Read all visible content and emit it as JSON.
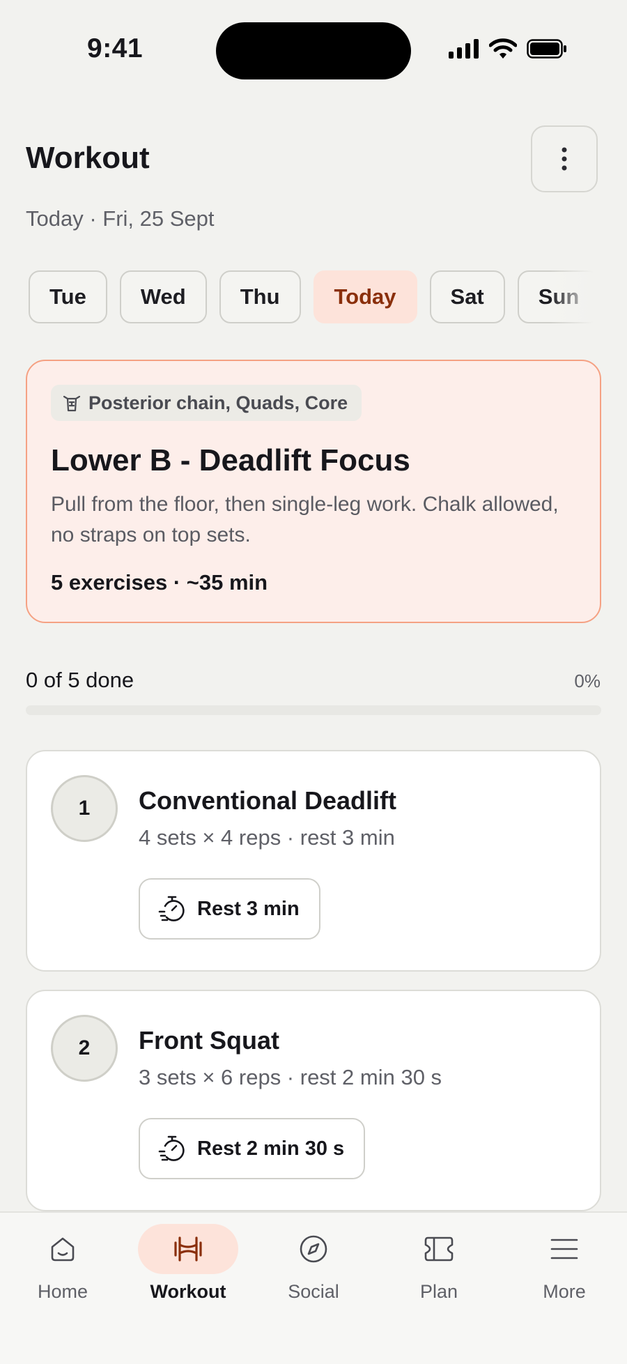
{
  "status": {
    "time": "9:41"
  },
  "header": {
    "title": "Workout",
    "subtitle": "Today · Fri, 25 Sept"
  },
  "days": [
    "Tue",
    "Wed",
    "Thu",
    "Today",
    "Sat",
    "Sun"
  ],
  "active_day": "Today",
  "workout": {
    "tag": "Posterior chain, Quads, Core",
    "title": "Lower B - Deadlift Focus",
    "description": "Pull from the floor, then single-leg work. Chalk allowed, no straps on top sets.",
    "meta": "5 exercises · ~35 min"
  },
  "progress": {
    "label": "0 of 5 done",
    "percent_label": "0%",
    "value": 0
  },
  "exercises": [
    {
      "number": "1",
      "name": "Conventional Deadlift",
      "detail": "4 sets × 4 reps · rest 3 min",
      "rest_label": "Rest 3 min"
    },
    {
      "number": "2",
      "name": "Front Squat",
      "detail": "3 sets × 6 reps · rest 2 min 30 s",
      "rest_label": "Rest 2 min 30 s"
    }
  ],
  "tabs": [
    {
      "label": "Home",
      "icon": "home-icon"
    },
    {
      "label": "Workout",
      "icon": "dumbbell-icon"
    },
    {
      "label": "Social",
      "icon": "compass-icon"
    },
    {
      "label": "Plan",
      "icon": "plan-icon"
    },
    {
      "label": "More",
      "icon": "menu-icon"
    }
  ],
  "active_tab": "Workout",
  "colors": {
    "accent": "#e06a3b",
    "accent_soft": "#fde3da",
    "accent_dark": "#8a2f0b",
    "background": "#f2f2ef"
  }
}
